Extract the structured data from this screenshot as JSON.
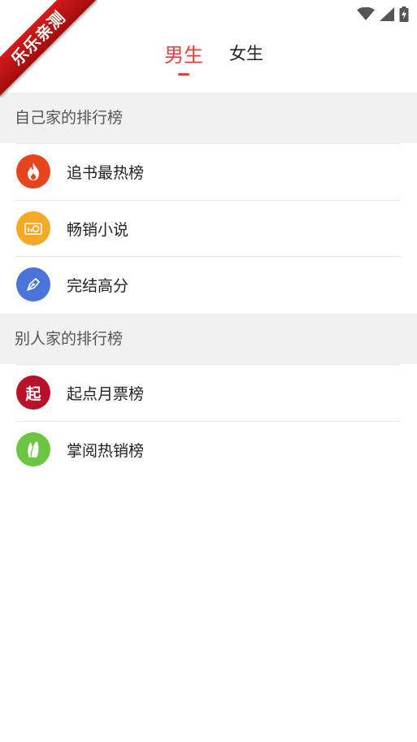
{
  "watermark": {
    "text": "乐乐亲测"
  },
  "status_bar": {
    "icons": [
      "wifi-icon",
      "cell-signal-icon",
      "battery-charging-icon"
    ]
  },
  "header": {
    "back_icon": "back-arrow-icon",
    "tabs": [
      {
        "label": "男生",
        "active": true
      },
      {
        "label": "女生",
        "active": false
      }
    ],
    "accent_color": "#e4413a"
  },
  "sections": [
    {
      "title": "自己家的排行榜",
      "items": [
        {
          "label": "追书最热榜",
          "icon": "flame-icon",
          "color": "#e5441d"
        },
        {
          "label": "畅销小说",
          "icon": "coin-register-icon",
          "color": "#f3ab25"
        },
        {
          "label": "完结高分",
          "icon": "pen-nib-icon",
          "color": "#4a74d9"
        }
      ]
    },
    {
      "title": "别人家的排行榜",
      "items": [
        {
          "label": "起点月票榜",
          "icon": "qidian-logo-icon",
          "icon_text": "起",
          "color": "#b81129"
        },
        {
          "label": "掌阅热销榜",
          "icon": "zhangyue-leaf-icon",
          "color": "#6cc443"
        }
      ]
    }
  ]
}
